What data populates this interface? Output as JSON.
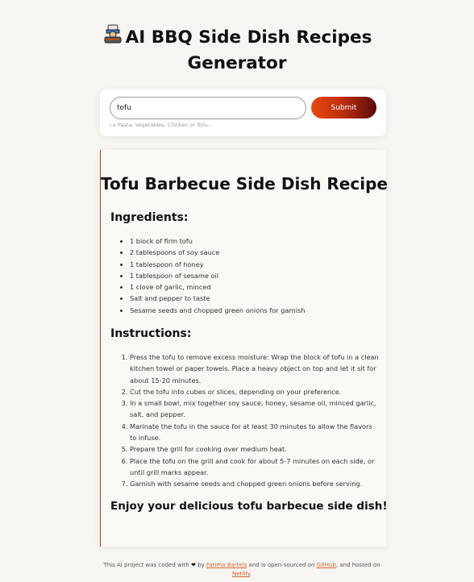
{
  "header": {
    "title_line1": "AI BBQ Side Dish Recipes",
    "title_line2": "Generator",
    "logo_icon": "grill-chef-icon"
  },
  "search": {
    "value": "tofu",
    "hint": "i.e Pasta, Vegetables, Chicken or Tofu...",
    "submit_label": "Submit"
  },
  "recipe": {
    "title": "Tofu Barbecue Side Dish Recipe",
    "ingredients_heading": "Ingredients:",
    "ingredients": [
      "1 block of firm tofu",
      "2 tablespoons of soy sauce",
      "1 tablespoon of honey",
      "1 tablespoon of sesame oil",
      "1 clove of garlic, minced",
      "Salt and pepper to taste",
      "Sesame seeds and chopped green onions for garnish"
    ],
    "instructions_heading": "Instructions:",
    "instructions": [
      "Press the tofu to remove excess moisture: Wrap the block of tofu in a clean kitchen towel or paper towels. Place a heavy object on top and let it sit for about 15-20 minutes.",
      "Cut the tofu into cubes or slices, depending on your preference.",
      "In a small bowl, mix together soy sauce, honey, sesame oil, minced garlic, salt, and pepper.",
      "Marinate the tofu in the sauce for at least 30 minutes to allow the flavors to infuse.",
      "Prepare the grill for cooking over medium heat.",
      "Place the tofu on the grill and cook for about 5-7 minutes on each side, or until grill marks appear.",
      "Garnish with sesame seeds and chopped green onions before serving."
    ],
    "closing": "Enjoy your delicious tofu barbecue side dish!"
  },
  "footer": {
    "text_before": "This AI project was coded with",
    "heart": "❤",
    "by": "by",
    "author": "Fatima Bartels",
    "middle": "and is open-sourced on",
    "github": "GitHub",
    "hosted": ", and hosted on",
    "netlify": "Netlify",
    "end": "."
  },
  "colors": {
    "accent": "#d9622e",
    "button_start": "#e5480c",
    "button_end": "#5a0a0a"
  }
}
